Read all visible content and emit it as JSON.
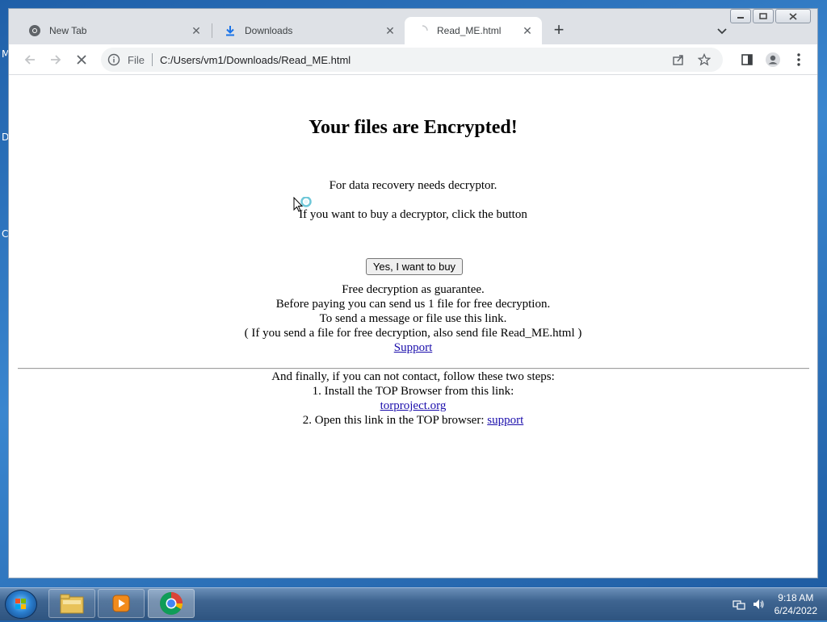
{
  "desktop": {
    "edge_fragments": [
      "M",
      "D",
      "C"
    ]
  },
  "browser": {
    "tabs": [
      {
        "label": "New Tab",
        "icon": "chrome-icon",
        "active": false
      },
      {
        "label": "Downloads",
        "icon": "download-icon",
        "active": false
      },
      {
        "label": "Read_ME.html",
        "icon": "loading-spinner-icon",
        "active": true
      }
    ],
    "new_tab_label": "+",
    "omnibox": {
      "scheme": "File",
      "url": "C:/Users/vm1/Downloads/Read_ME.html"
    }
  },
  "page": {
    "title": "Your files are Encrypted!",
    "recovery_text": "For data recovery needs decryptor.",
    "buy_prompt": "If you want to buy a decryptor, click the button",
    "buy_button_label": "Yes, I want to buy",
    "guarantee_lines": [
      "Free decryption as guarantee.",
      "Before paying you can send us 1 file for free decryption.",
      "To send a message or file use this link.",
      "( If you send a file for free decryption, also send file Read_ME.html )"
    ],
    "support_link": "Support",
    "steps_intro": "And finally, if you can not contact, follow these two steps:",
    "step1": "1. Install the TOP Browser from this link:",
    "tor_link": "torproject.org",
    "step2_prefix": "2. Open this link in the TOP browser: ",
    "step2_link": "support"
  },
  "taskbar": {
    "clock_time": "9:18 AM",
    "clock_date": "6/24/2022"
  }
}
